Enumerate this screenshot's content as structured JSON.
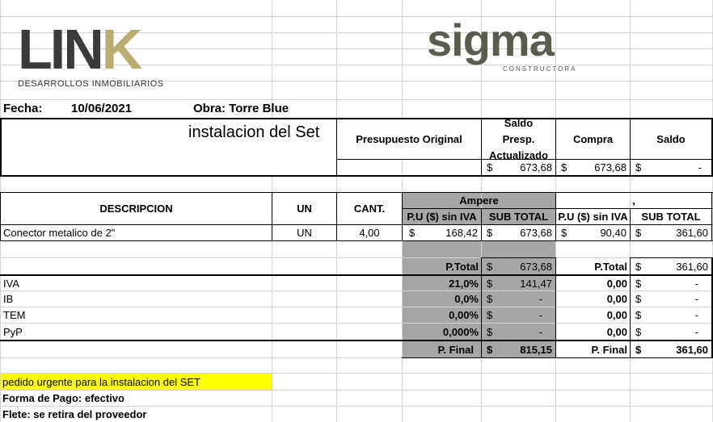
{
  "brand": {
    "link_logo": "LINK",
    "link_sub": "DESARROLLOS INMOBILIARIOS",
    "sigma_logo": "sigma",
    "sigma_sub": "CONSTRUCTORA",
    "link_accent_color": "#b9ad6f"
  },
  "header": {
    "fecha_label": "Fecha:",
    "fecha_value": "10/06/2021",
    "obra_label": "Obra: Torre Blue",
    "title": "instalacion del Set"
  },
  "summary": {
    "presupuesto_label": "Presupuesto Original",
    "saldo_presp_label": "Saldo Presp. Actualizado",
    "compra_label": "Compra",
    "saldo_label": "Saldo",
    "saldo_presp_value": "673,68",
    "compra_value": "673,68",
    "saldo_value": "-",
    "currency": "$"
  },
  "table": {
    "descripcion_header": "DESCRIPCION",
    "un_header": "UN",
    "cant_header": "CANT.",
    "supplier1": "Ampere",
    "supplier2": ",",
    "pu_header": "P.U ($) sin IVA",
    "subtotal_header": "SUB TOTAL",
    "row": {
      "descripcion": "Conector metalico de 2\"",
      "un": "UN",
      "cant": "4,00",
      "s1_pu": "168,42",
      "s1_sub": "673,68",
      "s2_pu": "90,40",
      "s2_sub": "361,60"
    }
  },
  "totals": {
    "ptotal_label": "P.Total",
    "s1_ptotal": "673,68",
    "s2_ptotal": "361,60",
    "taxes": [
      {
        "name": "IVA",
        "s1_rate": "21,0%",
        "s1_amount": "141,47",
        "s2_rate": "0,00",
        "s2_amount": "-"
      },
      {
        "name": "IB",
        "s1_rate": "0,0%",
        "s1_amount": "-",
        "s2_rate": "0,00",
        "s2_amount": "-"
      },
      {
        "name": "TEM",
        "s1_rate": "0,00%",
        "s1_amount": "-",
        "s2_rate": "0,00",
        "s2_amount": "-"
      },
      {
        "name": "PyP",
        "s1_rate": "0,000%",
        "s1_amount": "-",
        "s2_rate": "0,00",
        "s2_amount": "-"
      }
    ],
    "pfinal_label": "P. Final",
    "s1_pfinal": "815,15",
    "s2_pfinal": "361,60"
  },
  "notes": {
    "urgent": "pedido urgente para la instalacion del SET",
    "forma_pago": "Forma de Pago: efectivo",
    "flete": "Flete: se retira del proveedor"
  },
  "colors": {
    "grid": "#d4d4d4",
    "gray_fill": "#a6a6a6",
    "highlight": "#ffff00"
  }
}
